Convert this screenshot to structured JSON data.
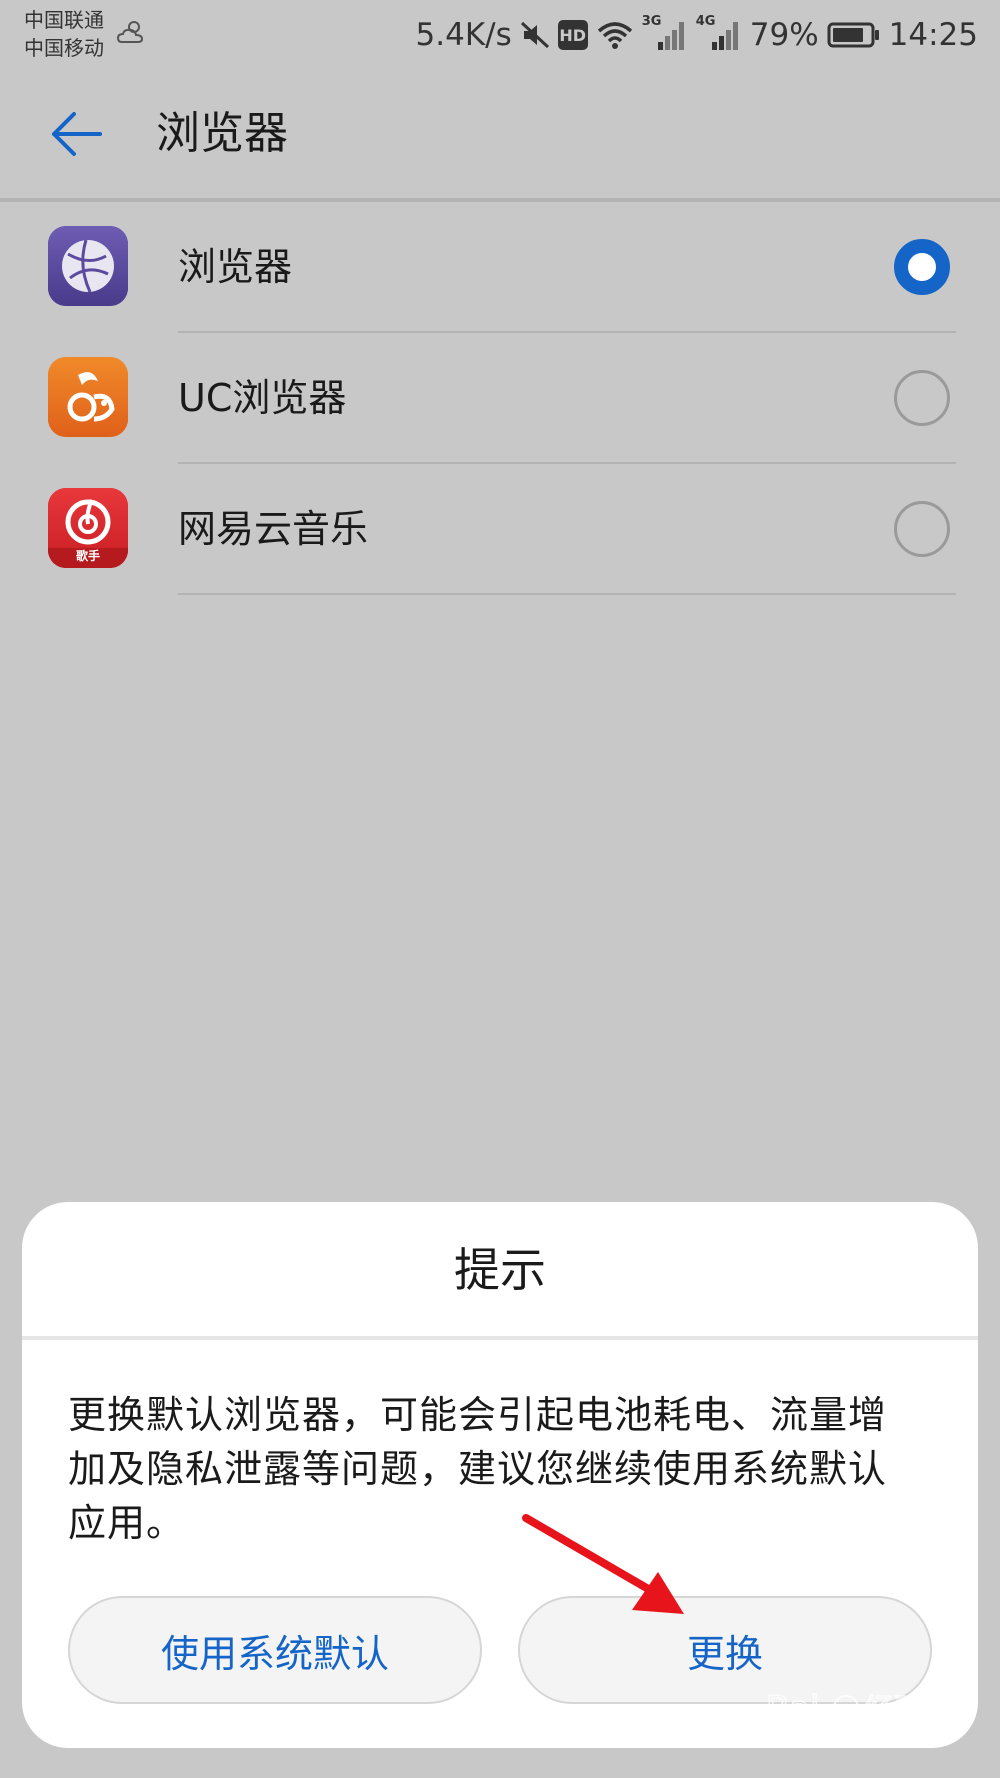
{
  "status_bar": {
    "carrier_1": "中国联通",
    "carrier_2": "中国移动",
    "net_speed": "5.4K/s",
    "hd_badge": "HD",
    "signal_3g": "3G",
    "signal_4g": "4G",
    "battery_percent": "79%",
    "time": "14:25",
    "icons": [
      "weather-cloudy-icon",
      "mute-icon",
      "hd-icon",
      "wifi-icon",
      "signal-3g-icon",
      "signal-4g-icon",
      "battery-icon"
    ]
  },
  "app_bar": {
    "title": "浏览器",
    "back_icon": "back-arrow-icon"
  },
  "apps": [
    {
      "label": "浏览器",
      "icon": "browser-globe-icon",
      "selected": true
    },
    {
      "label": "UC浏览器",
      "icon": "uc-squirrel-icon",
      "selected": false
    },
    {
      "label": "网易云音乐",
      "icon": "netease-music-icon",
      "selected": false
    }
  ],
  "dialog": {
    "title": "提示",
    "message": "更换默认浏览器，可能会引起电池耗电、流量增加及隐私泄露等问题，建议您继续使用系统默认应用。",
    "button_default": "使用系统默认",
    "button_change": "更换"
  },
  "netease_icon_caption": "歌手",
  "colors": {
    "accent_blue": "#1565c8",
    "scrim": "#c8c8c8",
    "annotation_red": "#e8141b",
    "browser_icon": "#5b4a9e",
    "uc_icon": "#e8701e",
    "netease_icon": "#d9272b"
  },
  "watermark": "Bai经验 jingyan.baidu.com"
}
